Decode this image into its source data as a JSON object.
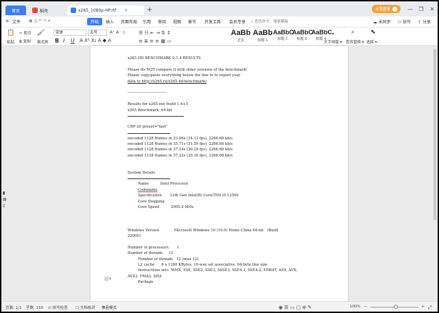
{
  "tabs": {
    "home": "首页",
    "template": "稻壳",
    "doc": "x265_1080p-HP.rtf",
    "add": "+"
  },
  "window": {
    "login": "点我登录",
    "min": "—",
    "max": "❐",
    "close": "✕"
  },
  "menu": {
    "file": "文件",
    "start": "开始",
    "insert": "插入",
    "layout": "页面布局",
    "reference": "引用",
    "review": "审阅",
    "view": "视图",
    "section": "章节",
    "dev": "开发工具",
    "vip": "会员专享",
    "search": "查找命令、搜索模板",
    "unsynced": "未同步",
    "collab": "协作",
    "share": "分享"
  },
  "toolbar": {
    "paste": "粘贴",
    "cut": "剪切",
    "copy": "复制",
    "format_painter": "格式刷",
    "font": "宋体",
    "size": "五号",
    "bold": "B",
    "italic": "I",
    "underline": "U",
    "styles": [
      {
        "preview": "AaBb",
        "name": "正文"
      },
      {
        "preview": "AaBb",
        "name": "标题 1"
      },
      {
        "preview": "AaBbC",
        "name": "标题 2"
      },
      {
        "preview": "AaBbC",
        "name": "标题 3"
      },
      {
        "preview": "AaBbC",
        "name": "标题 4"
      }
    ],
    "text_layout": "文字排版",
    "find_replace": "查找替换",
    "select": "选择"
  },
  "document": {
    "lines": [
      "x265 HD BENCHMARK 0.1.4 RESULTS",
      "",
      "Please do NOT compare it with older versions of the benchmark!",
      "Please copy/paste everything below the line to to report your",
      "data to http://x265.ru/x265-hd-benchmark/",
      "",
      "--------------------------------",
      "",
      "Results for x265.exe build 1.4+5",
      "x265 Benchmark: 64-bit"
    ],
    "crf_heading": "CRF-20 preset=\"fast\"",
    "encodes": [
      "encoded 1128 frames in 33.06s (34.12 fps), 2266.68 kb/s",
      "encoded 1128 frames in 35.71s (31.59 fps), 2266.68 kb/s",
      "encoded 1128 frames in 37.24s (30.29 fps), 2266.68 kb/s",
      "encoded 1128 frames in 37.22s (30.30 fps), 2266.68 kb/s"
    ],
    "system_heading": "System Details",
    "system": [
      "Name          Intel Processor",
      "Codename",
      "Specification       12th Gen Intel(R) Core(TM) i5-12500",
      "Core Stepping",
      "Core Speed          2995.4 MHz"
    ],
    "windows_version": "Windows Version             Microsoft Windows 10 (10.0) Home China 64-bit   (Build",
    "windows_build": "22000)",
    "processors": "Number of processors       1",
    "threads": "Number of threads     12",
    "threads2": "Number of threads   12 (max 12)",
    "l2": "L2 cache      6 x 1280 KBytes, 10-way set associative, 64-byte line size",
    "instructions": "Instructions sets  MMX, SSE, SSE2, SSE3, SSSE3, SSE4.1, SSE4.2, EM64T, AES, AVX,",
    "instructions2": "AVX2, FMA3, SHA",
    "package": "Package"
  },
  "status": {
    "page": "页面: 1/1",
    "words": "字数: 150",
    "spell": "拼写检查",
    "proof": "文档校对",
    "compat": "兼容模式",
    "zoom": "100%",
    "zoom_minus": "—",
    "zoom_plus": "+"
  },
  "colors": {
    "accent": "#3b7ded",
    "login": "#f2a33a"
  }
}
